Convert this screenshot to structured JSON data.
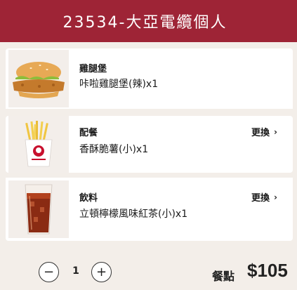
{
  "header": {
    "title": "23534-大亞電纜個人"
  },
  "items": [
    {
      "category": "雞腿堡",
      "name": "咔啦雞腿堡(辣)x1",
      "image_icon": "chicken-burger-image"
    },
    {
      "category": "配餐",
      "name": "香酥脆薯(小)x1",
      "change_label": "更換",
      "image_icon": "fries-image"
    },
    {
      "category": "飲料",
      "name": "立頓檸檬風味紅茶(小)x1",
      "change_label": "更換",
      "image_icon": "iced-tea-image"
    }
  ],
  "quantity": {
    "minus": "−",
    "value": "1",
    "plus": "+"
  },
  "price": {
    "label": "餐點",
    "value": "$105"
  },
  "colors": {
    "header": "#9e2436",
    "background": "#f3eee9"
  }
}
